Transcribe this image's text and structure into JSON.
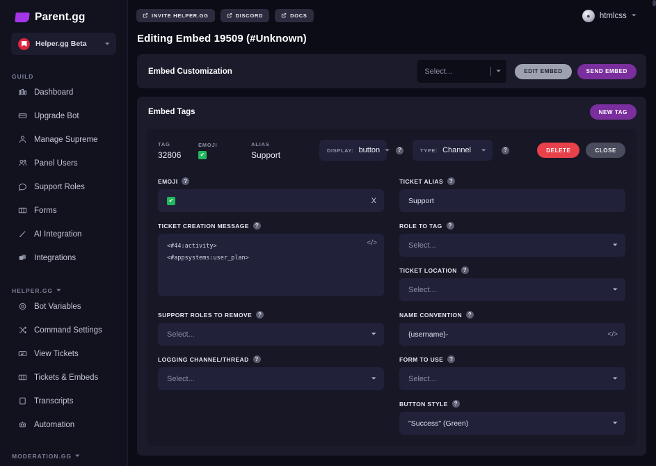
{
  "brand": {
    "name": "Parent.gg",
    "logo_icon": "flag-logo-icon",
    "accent": "#a435e8"
  },
  "guild_selector": {
    "name": "Helper.gg Beta",
    "avatar_icon": "book-avatar-icon",
    "chevron": "chevron-down-icon"
  },
  "sidebar": {
    "sections": [
      {
        "heading": "GUILD",
        "collapsible": false,
        "items": [
          {
            "label": "Dashboard",
            "icon": "dashboard-icon"
          },
          {
            "label": "Upgrade Bot",
            "icon": "credit-card-icon"
          },
          {
            "label": "Manage Supreme",
            "icon": "user-icon"
          },
          {
            "label": "Panel Users",
            "icon": "users-icon"
          },
          {
            "label": "Support Roles",
            "icon": "chat-icon"
          },
          {
            "label": "Forms",
            "icon": "columns-icon"
          },
          {
            "label": "AI Integration",
            "icon": "pencil-icon"
          },
          {
            "label": "Integrations",
            "icon": "layers-icon"
          }
        ]
      },
      {
        "heading": "HELPER.GG",
        "collapsible": true,
        "items": [
          {
            "label": "Bot Variables",
            "icon": "gear-icon"
          },
          {
            "label": "Command Settings",
            "icon": "shuffle-icon"
          },
          {
            "label": "View Tickets",
            "icon": "ticket-icon"
          },
          {
            "label": "Tickets & Embeds",
            "icon": "columns-icon"
          },
          {
            "label": "Transcripts",
            "icon": "document-icon"
          },
          {
            "label": "Automation",
            "icon": "robot-icon"
          }
        ]
      },
      {
        "heading": "MODERATION.GG",
        "collapsible": true,
        "items": []
      }
    ]
  },
  "topbar": {
    "buttons": [
      {
        "label": "INVITE HELPER.GG",
        "icon": "external-link-icon"
      },
      {
        "label": "DISCORD",
        "icon": "external-link-icon"
      },
      {
        "label": "DOCS",
        "icon": "external-link-icon"
      }
    ],
    "user": {
      "name": "htmlcss",
      "avatar_icon": "user-avatar-icon",
      "chevron": "chevron-down-icon"
    }
  },
  "page": {
    "title": "Editing Embed 19509 (#Unknown)"
  },
  "customization": {
    "title": "Embed Customization",
    "select_placeholder": "Select...",
    "edit_label": "EDIT EMBED",
    "send_label": "SEND EMBED",
    "edit_color": "#9ea2b0",
    "send_color": "#7b2f9e"
  },
  "embed_tags": {
    "title": "Embed Tags",
    "new_tag_label": "NEW TAG"
  },
  "tag": {
    "meta": [
      {
        "label": "TAG",
        "value": "32806"
      },
      {
        "label": "EMOJI",
        "value": "✔",
        "type": "checkmark"
      },
      {
        "label": "ALIAS",
        "value": "Support"
      }
    ],
    "display": {
      "prefix": "DISPLAY:",
      "value": "button",
      "help": "?"
    },
    "type": {
      "prefix": "TYPE:",
      "value": "Channel",
      "help": "?"
    },
    "delete_label": "DELETE",
    "close_label": "CLOSE",
    "delete_color": "#e8414a",
    "close_color": "#4a4c5d",
    "fields": {
      "emoji": {
        "label": "EMOJI",
        "help": "?",
        "value": "✔",
        "clear": "X"
      },
      "ticket_alias": {
        "label": "TICKET ALIAS",
        "help": "?",
        "value": "Support"
      },
      "ticket_creation_message": {
        "label": "TICKET CREATION MESSAGE",
        "help": "?",
        "lines": [
          "<#44:activity>",
          "<#appsystems:user_plan>"
        ],
        "code_icon": "</>"
      },
      "role_to_tag": {
        "label": "ROLE TO TAG",
        "help": "?",
        "placeholder": "Select..."
      },
      "ticket_location": {
        "label": "TICKET LOCATION",
        "help": "?",
        "placeholder": "Select..."
      },
      "support_roles_to_remove": {
        "label": "SUPPORT ROLES TO REMOVE",
        "help": "?",
        "placeholder": "Select..."
      },
      "name_convention": {
        "label": "NAME CONVENTION",
        "help": "?",
        "value": "{username}-",
        "code_icon": "</>"
      },
      "logging_channel": {
        "label": "LOGGING CHANNEL/THREAD",
        "help": "?",
        "placeholder": "Select..."
      },
      "form_to_use": {
        "label": "FORM TO USE",
        "help": "?",
        "placeholder": "Select..."
      },
      "button_style": {
        "label": "BUTTON STYLE",
        "help": "?",
        "value": "\"Success\" (Green)"
      }
    }
  }
}
